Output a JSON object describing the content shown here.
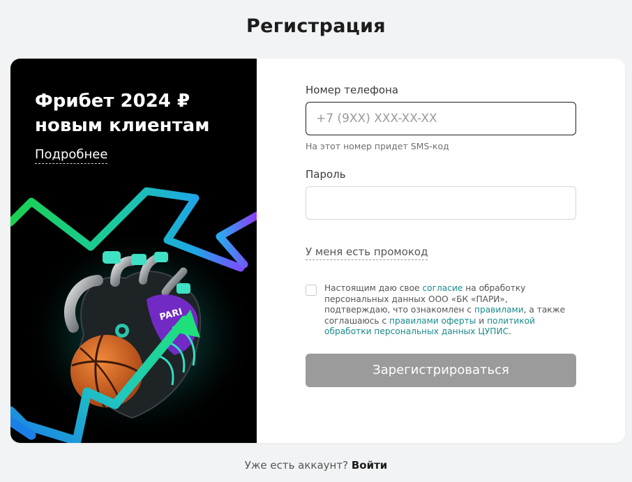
{
  "page": {
    "title": "Регистрация"
  },
  "promo": {
    "title_line1": "Фрибет 2024 ₽",
    "title_line2": "новым клиентам",
    "more_link": "Подробнее",
    "art_badge": "PARI"
  },
  "form": {
    "phone": {
      "label": "Номер телефона",
      "placeholder": "+7 (9XX) XXX-XX-XX",
      "hint": "На этот номер придет SMS-код"
    },
    "password": {
      "label": "Пароль",
      "value": ""
    },
    "promo_code_link": "У меня есть промокод",
    "consent": {
      "checked": false,
      "text_1": "Настоящим даю свое ",
      "link_consent": "согласие",
      "text_2": " на обработку персональных данных ООО «БК «ПАРИ», подтверждаю, что ознакомлен с ",
      "link_rules": "правилами",
      "text_3": ", а также соглашаюсь с ",
      "link_offer": "правилами оферты",
      "text_4": " и ",
      "link_policy": "политикой обработки персональных данных ЦУПИС",
      "text_5": "."
    },
    "submit_label": "Зарегистрироваться"
  },
  "footer": {
    "question": "Уже есть аккаунт?",
    "login_link": "Войти"
  },
  "colors": {
    "background": "#f2f3f4",
    "card": "#ffffff",
    "promo_bg": "#000000",
    "link_teal": "#1a8a8d",
    "button_disabled": "#9b9b9b"
  }
}
